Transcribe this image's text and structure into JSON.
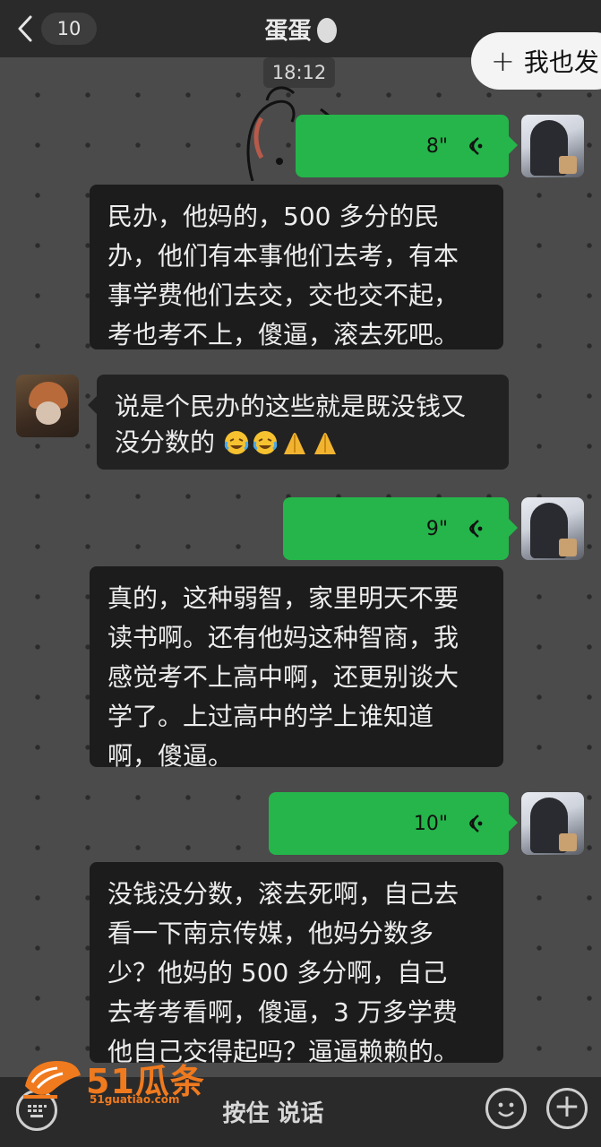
{
  "header": {
    "unread_count": "10",
    "title": "蛋蛋",
    "more": "···",
    "share_plus": "+",
    "share_label": "我也发"
  },
  "timestamp": "18:12",
  "messages": [
    {
      "type": "voice",
      "sender": "self",
      "duration": "8\""
    },
    {
      "type": "transcript",
      "text": "民办，他妈的，500 多分的民\n办，他们有本事他们去考，有本\n事学费他们去交，交也交不起，\n考也考不上，傻逼，滚去死吧。"
    },
    {
      "type": "text",
      "sender": "other",
      "text_line1": "说是个民办的这些就是既没钱又",
      "text_line2": "没分数的"
    },
    {
      "type": "voice",
      "sender": "self",
      "duration": "9\""
    },
    {
      "type": "transcript",
      "text": "真的，这种弱智，家里明天不要\n读书啊。还有他妈这种智商，我\n感觉考不上高中啊，还更别谈大\n学了。上过高中的学上谁知道\n啊，傻逼。"
    },
    {
      "type": "voice",
      "sender": "self",
      "duration": "10\""
    },
    {
      "type": "transcript",
      "text": "没钱没分数，滚去死啊，自己去\n看一下南京传媒，他妈分数多\n少？他妈的 500 多分啊，自己\n去考考看啊，傻逼，3 万多学费\n他自己交得起吗？逼逼赖赖的。"
    }
  ],
  "bottombar": {
    "hold_to_talk": "按住 说话",
    "plus": "+"
  },
  "watermark": {
    "name": "51瓜条",
    "url": "51guatiao.com"
  },
  "colors": {
    "voice_bubble": "#25b54a",
    "logo": "#f07a1e"
  }
}
